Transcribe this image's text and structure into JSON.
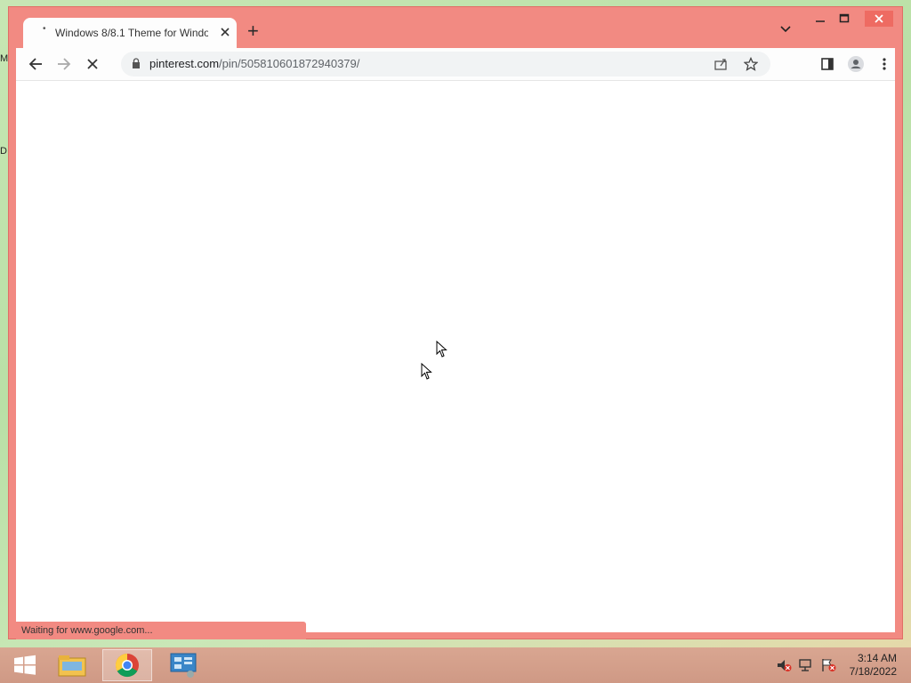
{
  "desktop": {
    "edge_labels": [
      "M",
      "D"
    ]
  },
  "browser": {
    "tab_title": "Windows 8/8.1 Theme for Windo",
    "new_tab_label": "+",
    "address_host": "pinterest.com",
    "address_path": "/pin/505810601872940379/",
    "status_text": "Waiting for www.google.com...",
    "accent_color": "#f28a82"
  },
  "taskbar": {
    "time": "3:14 AM",
    "date": "7/18/2022",
    "items": [
      "start-icon",
      "file-explorer-icon",
      "chrome-icon",
      "control-panel-icon"
    ]
  }
}
